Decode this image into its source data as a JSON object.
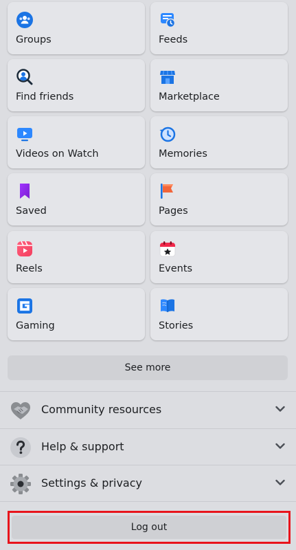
{
  "shortcuts": [
    {
      "label": "Groups",
      "icon": "groups-icon"
    },
    {
      "label": "Feeds",
      "icon": "feeds-icon"
    },
    {
      "label": "Find friends",
      "icon": "find-friends-icon"
    },
    {
      "label": "Marketplace",
      "icon": "marketplace-icon"
    },
    {
      "label": "Videos on Watch",
      "icon": "watch-videos-icon"
    },
    {
      "label": "Memories",
      "icon": "memories-icon"
    },
    {
      "label": "Saved",
      "icon": "saved-bookmark-icon"
    },
    {
      "label": "Pages",
      "icon": "pages-flag-icon"
    },
    {
      "label": "Reels",
      "icon": "reels-icon"
    },
    {
      "label": "Events",
      "icon": "events-calendar-icon"
    },
    {
      "label": "Gaming",
      "icon": "gaming-icon"
    },
    {
      "label": "Stories",
      "icon": "stories-book-icon"
    }
  ],
  "see_more_label": "See more",
  "sections": [
    {
      "label": "Community resources",
      "icon": "handshake-heart-icon"
    },
    {
      "label": "Help & support",
      "icon": "question-mark-icon"
    },
    {
      "label": "Settings & privacy",
      "icon": "gear-icon"
    }
  ],
  "logout_label": "Log out",
  "colors": {
    "background": "#dcdde1",
    "tile": "#e4e5e9",
    "accent_blue": "#1877f2",
    "highlight_red": "#e8141c"
  }
}
